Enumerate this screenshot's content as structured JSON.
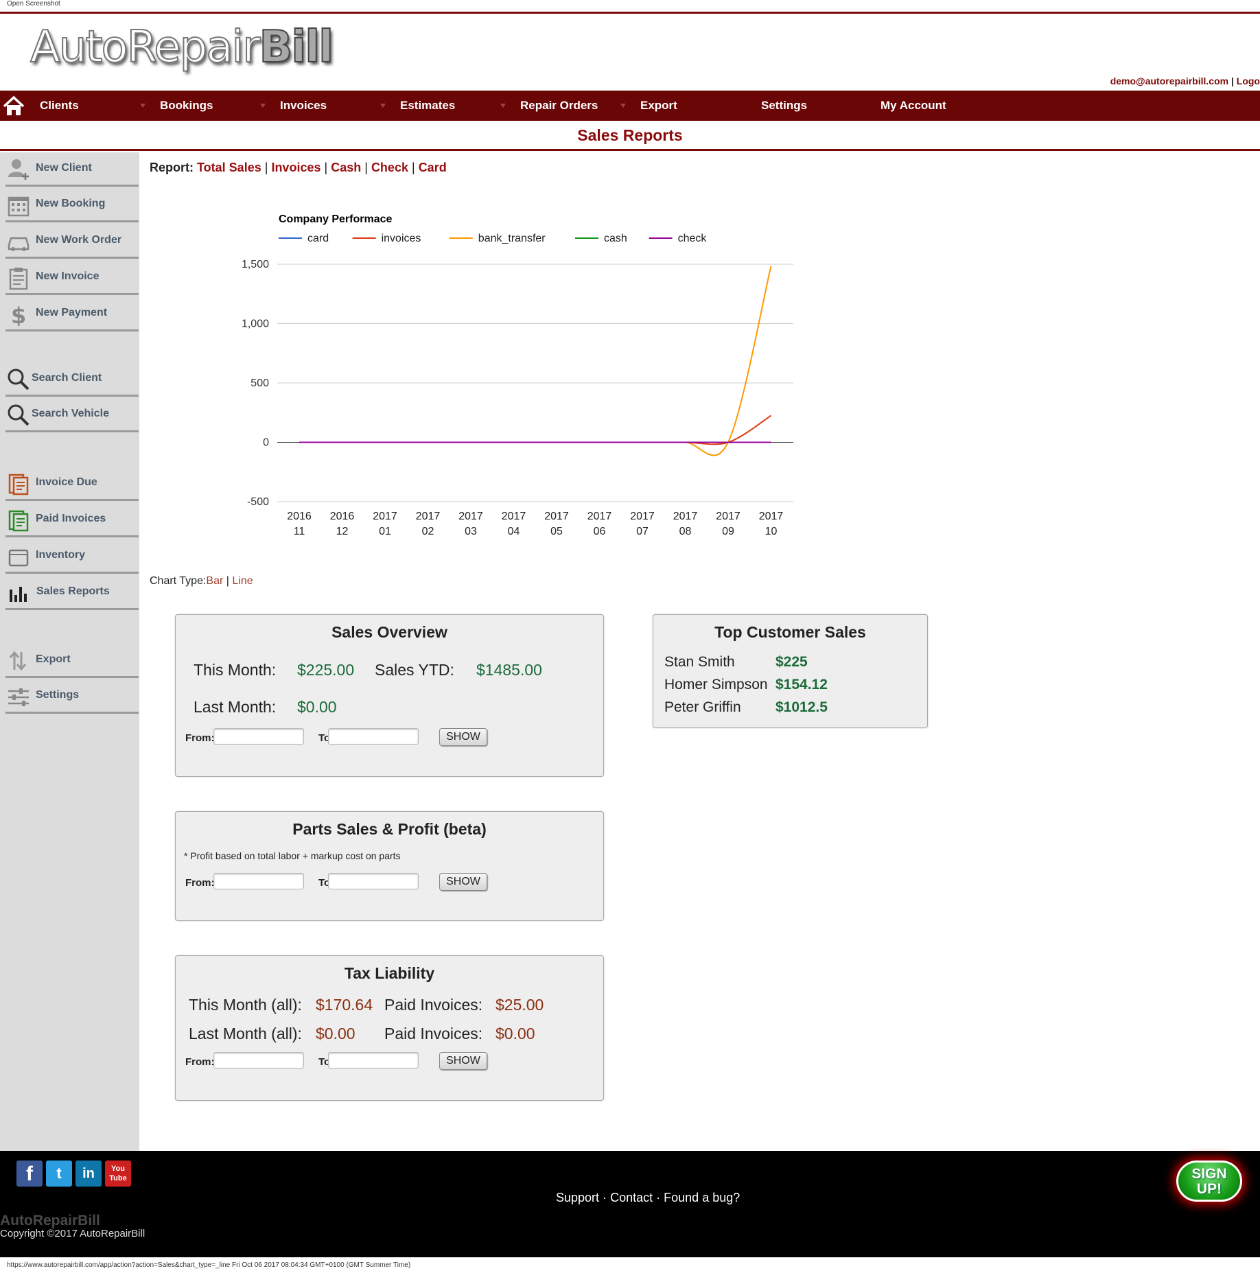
{
  "window": {
    "title": "Open Screenshot"
  },
  "header": {
    "logo_part1": "AutoRepair",
    "logo_part2": "Bill",
    "account_email": "demo@autorepairbill.com",
    "account_separator": "|",
    "logout_label": "Logo"
  },
  "nav": {
    "items": [
      "Clients",
      "Bookings",
      "Invoices",
      "Estimates",
      "Repair Orders",
      "Export",
      "Settings",
      "My Account"
    ]
  },
  "page": {
    "title": "Sales Reports"
  },
  "sidebar": {
    "items": [
      {
        "label": "New Client",
        "icon": "add-user-icon"
      },
      {
        "label": "New Booking",
        "icon": "calendar-icon"
      },
      {
        "label": "New Work Order",
        "icon": "car-icon"
      },
      {
        "label": "New Invoice",
        "icon": "clipboard-icon"
      },
      {
        "label": "New Payment",
        "icon": "dollar-icon"
      },
      {
        "label": "Search Client",
        "icon": "search-icon"
      },
      {
        "label": "Search Vehicle",
        "icon": "search-icon"
      },
      {
        "label": "Invoice Due",
        "icon": "invoice-due-icon"
      },
      {
        "label": "Paid Invoices",
        "icon": "paid-invoices-icon"
      },
      {
        "label": "Inventory",
        "icon": "inventory-icon"
      },
      {
        "label": "Sales Reports",
        "icon": "bar-chart-icon"
      },
      {
        "label": "Export",
        "icon": "export-icon"
      },
      {
        "label": "Settings",
        "icon": "sliders-icon"
      }
    ]
  },
  "report": {
    "label": "Report:",
    "links": [
      "Total Sales",
      "Invoices",
      "Cash",
      "Check",
      "Card"
    ],
    "separator": "|"
  },
  "chart_data": {
    "type": "line",
    "title": "Company Performace",
    "xlabel": "",
    "ylabel": "",
    "x": [
      "2016 11",
      "2016 12",
      "2017 01",
      "2017 02",
      "2017 03",
      "2017 04",
      "2017 05",
      "2017 06",
      "2017 07",
      "2017 08",
      "2017 09",
      "2017 10"
    ],
    "x_tick_lines": [
      [
        "2016",
        "11"
      ],
      [
        "2016",
        "12"
      ],
      [
        "2017",
        "01"
      ],
      [
        "2017",
        "02"
      ],
      [
        "2017",
        "03"
      ],
      [
        "2017",
        "04"
      ],
      [
        "2017",
        "05"
      ],
      [
        "2017",
        "06"
      ],
      [
        "2017",
        "07"
      ],
      [
        "2017",
        "08"
      ],
      [
        "2017",
        "09"
      ],
      [
        "2017",
        "10"
      ]
    ],
    "ylim": [
      -500,
      1500
    ],
    "yticks": [
      -500,
      0,
      500,
      1000,
      1500
    ],
    "ytick_labels": [
      "-500",
      "0",
      "500",
      "1,000",
      "1,500"
    ],
    "grid": true,
    "legend": "top",
    "smooth": true,
    "series": [
      {
        "name": "card",
        "color": "#3366cc",
        "values": [
          0,
          0,
          0,
          0,
          0,
          0,
          0,
          0,
          0,
          0,
          0,
          0
        ]
      },
      {
        "name": "invoices",
        "color": "#dc3912",
        "values": [
          0,
          0,
          0,
          0,
          0,
          0,
          0,
          0,
          0,
          0,
          0,
          225
        ]
      },
      {
        "name": "bank_transfer",
        "color": "#ff9900",
        "values": [
          0,
          0,
          0,
          0,
          0,
          0,
          0,
          0,
          0,
          0,
          0,
          1485
        ]
      },
      {
        "name": "cash",
        "color": "#109618",
        "values": [
          0,
          0,
          0,
          0,
          0,
          0,
          0,
          0,
          0,
          0,
          0,
          0
        ]
      },
      {
        "name": "check",
        "color": "#990099",
        "values": [
          0,
          0,
          0,
          0,
          0,
          0,
          0,
          0,
          0,
          0,
          0,
          0
        ]
      }
    ]
  },
  "chart_type": {
    "label": "Chart Type:",
    "bar": "Bar",
    "separator": "|",
    "line": "Line"
  },
  "sales_overview": {
    "title": "Sales Overview",
    "this_month_label": "This Month:",
    "this_month_value": "$225.00",
    "ytd_label": "Sales YTD:",
    "ytd_value": "$1485.00",
    "last_month_label": "Last Month:",
    "last_month_value": "$0.00"
  },
  "date_form": {
    "from_label": "From:",
    "to_label": "To:",
    "show_label": "SHOW"
  },
  "top_customers": {
    "title": "Top Customer Sales",
    "rows": [
      {
        "name": "Stan Smith",
        "amount": "$225"
      },
      {
        "name": "Homer Simpson",
        "amount": "$154.12"
      },
      {
        "name": "Peter Griffin",
        "amount": "$1012.5"
      }
    ]
  },
  "parts": {
    "title": "Parts Sales & Profit (beta)",
    "note": "* Profit based on total labor + markup cost on parts"
  },
  "tax": {
    "title": "Tax Liability",
    "this_month_label": "This Month (all):",
    "this_month_value": "$170.64",
    "this_paid_label": "Paid Invoices:",
    "this_paid_value": "$25.00",
    "last_month_label": "Last Month (all):",
    "last_month_value": "$0.00",
    "last_paid_label": "Paid Invoices:",
    "last_paid_value": "$0.00"
  },
  "footer": {
    "social": [
      "f",
      "t",
      "in",
      "You Tube"
    ],
    "links": [
      "Support",
      "Contact",
      "Found a bug?"
    ],
    "link_separator": "·",
    "brand": "AutoRepairBill",
    "copyright": "Copyright ©2017 AutoRepairBill",
    "signup_line1": "SIGN",
    "signup_line2": "UP!"
  },
  "statusbar": {
    "text": "https://www.autorepairbill.com/app/action?action=Sales&chart_type=_line Fri Oct 06 2017 08:04:34 GMT+0100 (GMT Summer Time)"
  },
  "colors": {
    "brand_red": "#6b0606",
    "title_red": "#8b0a0a",
    "money_green": "#1c6b3a",
    "money_brown": "#8a2e10"
  }
}
